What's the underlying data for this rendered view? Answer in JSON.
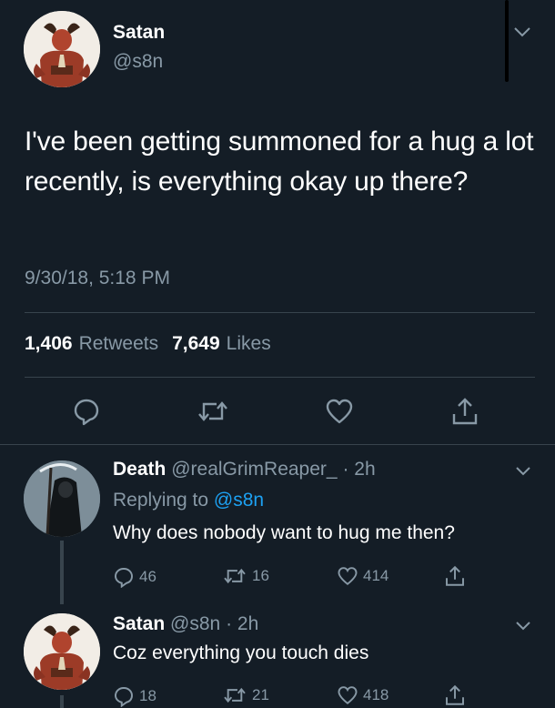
{
  "main_tweet": {
    "display_name": "Satan",
    "handle": "@s8n",
    "text": "I've been getting summoned for a hug a lot recently, is everything okay up there?",
    "timestamp": "9/30/18, 5:18 PM",
    "retweets_count": "1,406",
    "retweets_label": "Retweets",
    "likes_count": "7,649",
    "likes_label": "Likes",
    "actions": [
      "reply-icon",
      "retweet-icon",
      "heart-icon",
      "share-icon"
    ]
  },
  "replies": [
    {
      "display_name": "Death",
      "handle": "@realGrimReaper_",
      "time": "· 2h",
      "replying_prefix": "Replying to",
      "replying_to": "@s8n",
      "text": "Why does nobody want to hug me then?",
      "reply_count": "46",
      "retweet_count": "16",
      "like_count": "414"
    },
    {
      "display_name": "Satan",
      "handle": "@s8n",
      "time": "· 2h",
      "text": "Coz everything you touch dies",
      "reply_count": "18",
      "retweet_count": "21",
      "like_count": "418"
    }
  ],
  "colors": {
    "background": "#141d26",
    "secondary_text": "#8899a6",
    "link": "#1da1f2",
    "divider": "#38444d"
  }
}
